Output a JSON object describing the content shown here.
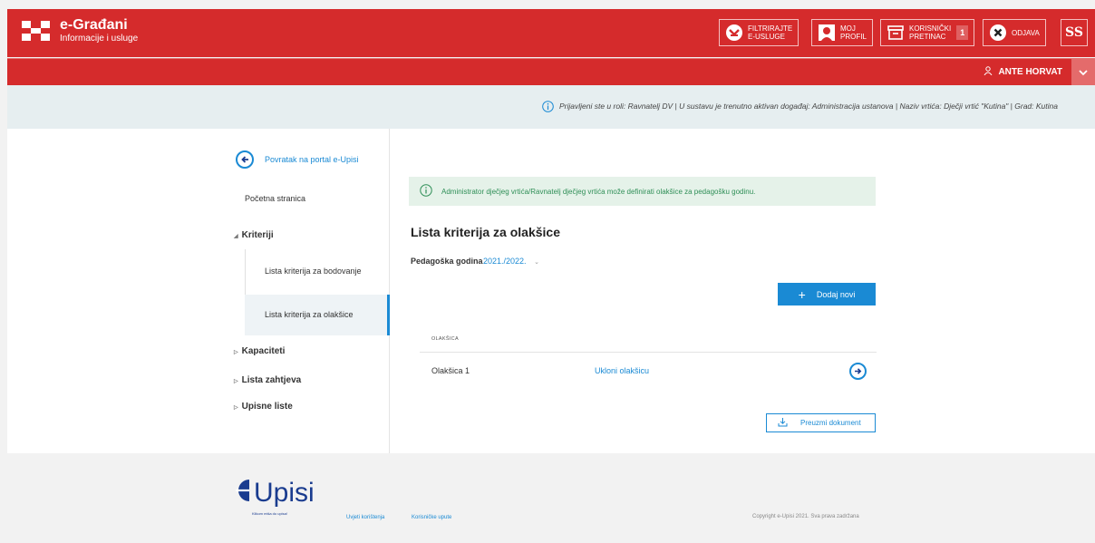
{
  "header": {
    "brand_title": "e-Građani",
    "brand_subtitle": "Informacije i usluge",
    "buttons": {
      "filter_line1": "FILTRIRAJTE",
      "filter_line2": "E-USLUGE",
      "profile_line1": "MOJ",
      "profile_line2": "PROFIL",
      "inbox_line1": "KORISNIČKI",
      "inbox_line2": "PRETINAC",
      "inbox_count": "1",
      "logout": "ODJAVA",
      "accessibility": "ß"
    },
    "user_name": "ANTE HORVAT"
  },
  "info_bar": {
    "text": "Prijavljeni ste u roli: Ravnatelj DV | U sustavu je trenutno aktivan događaj: Administracija ustanova | Naziv vrtića: Dječji vrtić \"Kutina\" | Grad: Kutina"
  },
  "sidebar": {
    "back_link": "Povratak na portal e-Upisi",
    "home": "Početna stranica",
    "criteria": "Kriteriji",
    "criteria_scoring": "Lista kriterija za bodovanje",
    "criteria_relief": "Lista kriterija za olakšice",
    "capacities": "Kapaciteti",
    "requests": "Lista zahtjeva",
    "enrollment_lists": "Upisne liste"
  },
  "main": {
    "alert": "Administrator dječjeg vrtića/Ravnatelj dječjeg vrtića može definirati olakšice za pedagošku godinu.",
    "title": "Lista kriterija za olakšice",
    "year_label": "Pedagoška godina",
    "year_value": "2021./2022.",
    "add_button": "Dodaj novi",
    "table_header": "OLAKŠICA",
    "rows": [
      {
        "name": "Olakšica 1",
        "action": "Ukloni olakšicu"
      }
    ],
    "download_button": "Preuzmi dokument"
  },
  "footer": {
    "logo_text": "Upisi",
    "logo_tagline": "Klikom miša do upisa!",
    "terms": "Uvjeti korištenja",
    "user_guide": "Korisničke upute",
    "copyright": "Copyright e-Upisi 2021. Sva prava zadržana"
  },
  "colors": {
    "primary_red": "#d52b2c",
    "accent_blue": "#1a8ad4",
    "success_green": "#2f8f57"
  }
}
